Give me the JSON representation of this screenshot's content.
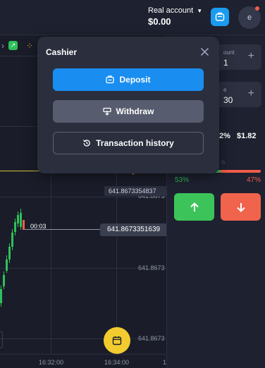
{
  "account": {
    "label": "Real account",
    "balance": "$0.00",
    "avatar_initial": "e"
  },
  "chart": {
    "yticks": [
      "641.8673",
      "641.8673",
      "641.8673"
    ],
    "price_tag_high": "641.8673354837",
    "price_tag_current": "641.8673351639",
    "timer": "00:03",
    "xticks": [
      "16:32:00",
      "16:34:00",
      "1"
    ]
  },
  "panel": {
    "amount_label": "ount",
    "amount_value": "1",
    "time_label": "e",
    "time_value": "30",
    "payout_pct": "2%",
    "payout_value": "$1.82",
    "faded_text": "n",
    "pct_up": "53%",
    "pct_down": "47%",
    "pct_up_fraction": 0.53
  },
  "modal": {
    "title": "Cashier",
    "deposit_label": "Deposit",
    "withdraw_label": "Withdraw",
    "history_label": "Transaction history"
  },
  "colors": {
    "accent_blue": "#1a8df0",
    "up_green": "#3cc45a",
    "down_red": "#f0634c",
    "fab_yellow": "#f2cc2f"
  }
}
